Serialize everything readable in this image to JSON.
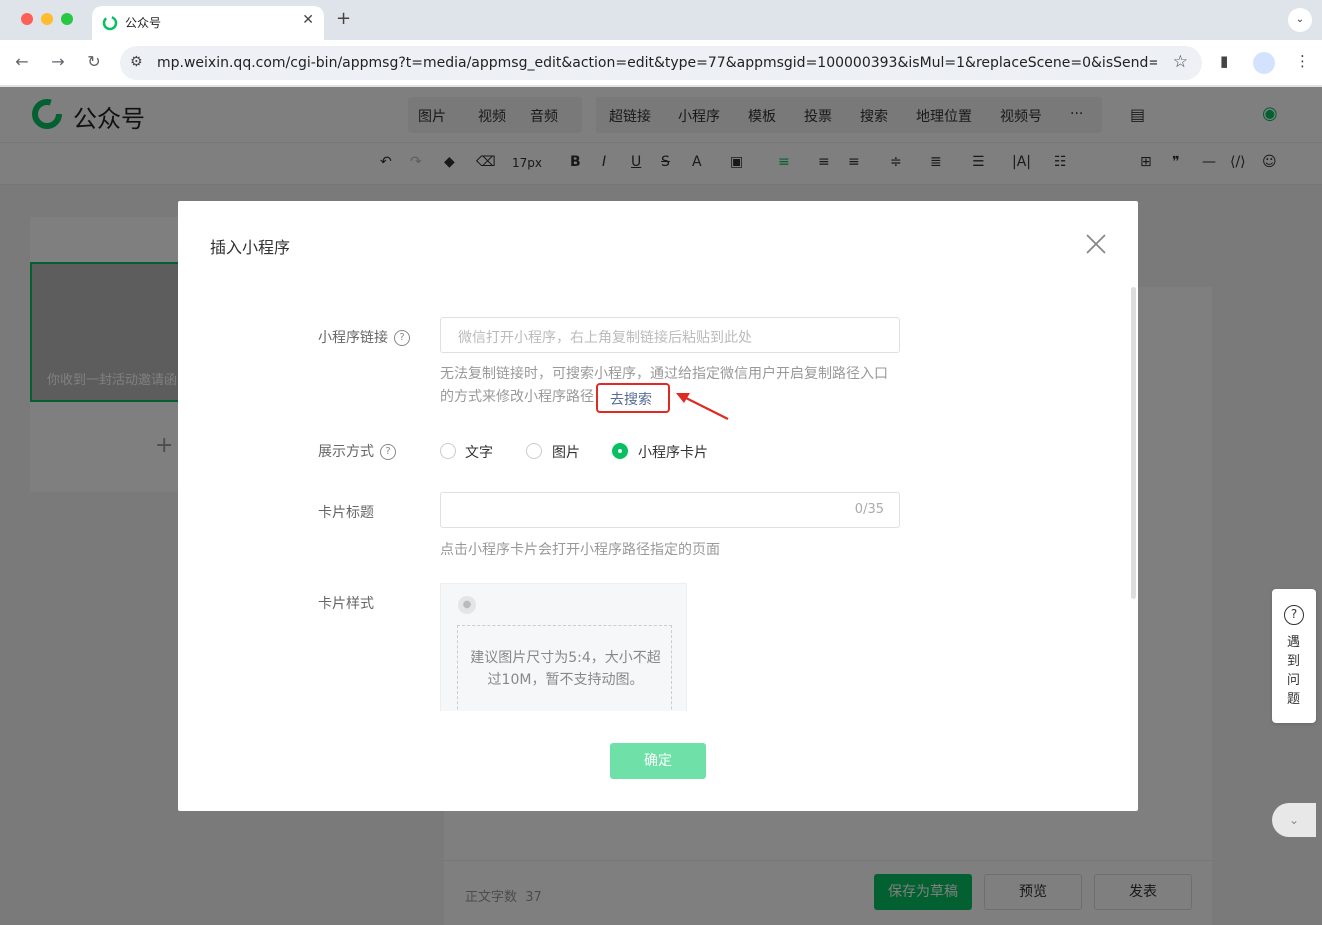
{
  "browser": {
    "tab_title": "公众号",
    "url": "mp.weixin.qq.com/cgi-bin/appmsg?t=media/appmsg_edit&action=edit&type=77&appmsgid=100000393&isMul=1&replaceScene=0&isSend=0&isFree..."
  },
  "app": {
    "logo_text": "公众号",
    "menu_group_1": [
      "图片",
      "视频",
      "音频"
    ],
    "menu_group_2": [
      "超链接",
      "小程序",
      "模板",
      "投票",
      "搜索",
      "地理位置",
      "视频号"
    ],
    "font_size": "17px",
    "left_card_text": "你收到一封活动邀请函",
    "word_count_label": "正文字数",
    "word_count": "37",
    "save_draft": "保存为草稿",
    "preview": "预览",
    "publish": "发表"
  },
  "help": {
    "text": "遇到问题"
  },
  "modal": {
    "title": "插入小程序",
    "link_label": "小程序链接",
    "link_placeholder": "微信打开小程序，右上角复制链接后粘贴到此处",
    "link_hint_line1": "无法复制链接时，可搜索小程序，通过给指定微信用户开启复制路径入口",
    "link_hint_line2": "的方式来修改小程序路径",
    "search_link": "去搜索",
    "display_label": "展示方式",
    "display_options": [
      {
        "label": "文字",
        "selected": false
      },
      {
        "label": "图片",
        "selected": false
      },
      {
        "label": "小程序卡片",
        "selected": true
      }
    ],
    "card_title_label": "卡片标题",
    "card_title_counter": "0/35",
    "card_title_hint": "点击小程序卡片会打开小程序路径指定的页面",
    "card_style_label": "卡片样式",
    "card_style_hint": "建议图片尺寸为5:4，大小不超过10M，暂不支持动图。",
    "confirm": "确定"
  },
  "colors": {
    "brand_green": "#07c160",
    "confirm_disabled": "#6ee0a8",
    "link_blue": "#576b95",
    "annotation_red": "#e02b24"
  }
}
